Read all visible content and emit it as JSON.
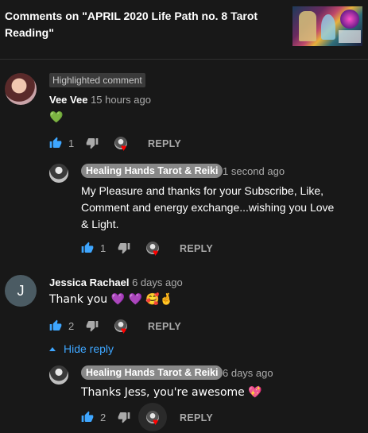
{
  "header": {
    "title": "Comments on \"APRIL 2020 Life Path no. 8 Tarot Reading\""
  },
  "comments": [
    {
      "badge": "Highlighted comment",
      "author": "Vee Vee",
      "time": "15 hours ago",
      "text": "💚",
      "likes": "1",
      "reply_label": "REPLY",
      "reply": {
        "author": "Healing Hands Tarot & Reiki",
        "time": "1 second ago",
        "text": "My Pleasure and thanks for your Subscribe, Like, Comment and  energy exchange...wishing you Love & Light.",
        "likes": "1",
        "reply_label": "REPLY"
      }
    },
    {
      "avatar_letter": "J",
      "author": "Jessica Rachael",
      "time": "6 days ago",
      "text": "Thank you 💜 💜 🥰🤞",
      "likes": "2",
      "reply_label": "REPLY",
      "hide_reply": "Hide reply",
      "reply": {
        "author": "Healing Hands Tarot & Reiki",
        "time": "6 days ago",
        "text": "Thanks Jess, you're awesome 💖",
        "likes": "2",
        "reply_label": "REPLY"
      }
    }
  ],
  "icons": {
    "like": "thumbs-up-icon",
    "dislike": "thumbs-down-icon",
    "creator_heart": "creator-heart-icon",
    "hide": "caret-up-icon"
  },
  "colors": {
    "background": "#181818",
    "link": "#3ea6ff",
    "like": "#3ea6ff",
    "heart": "#ff0000"
  }
}
